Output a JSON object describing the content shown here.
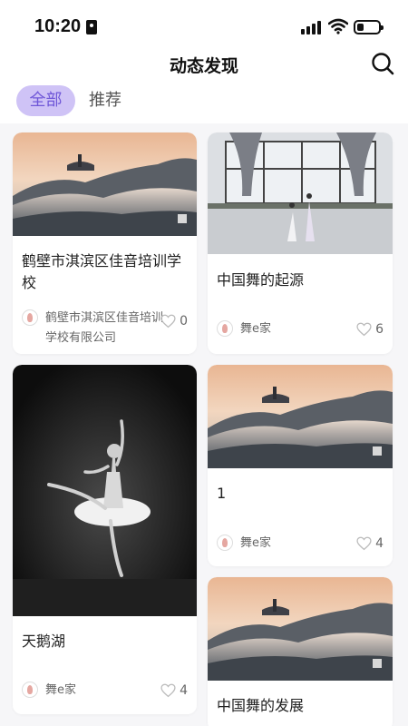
{
  "status_bar": {
    "time": "10:20"
  },
  "header": {
    "title": "动态发现"
  },
  "tabs": [
    {
      "label": "全部",
      "active": true
    },
    {
      "label": "推荐",
      "active": false
    }
  ],
  "cards": [
    {
      "title": "鹤壁市淇滨区佳音培训学校",
      "author": "鹤壁市淇滨区佳音培训学校有限公司",
      "likes": "0",
      "image": "landscape-pavilion"
    },
    {
      "title": "中国舞的起源",
      "author": "舞e家",
      "likes": "6",
      "image": "dance-studio"
    },
    {
      "title": "天鹅湖",
      "author": "舞e家",
      "likes": "4",
      "image": "ballerina-bw"
    },
    {
      "title": "1",
      "author": "舞e家",
      "likes": "4",
      "image": "landscape-pavilion"
    },
    {
      "title": "中国舞的发展",
      "author": "",
      "likes": "",
      "image": "landscape-pavilion"
    }
  ],
  "colors": {
    "accent": "#6f57d8",
    "accent_bg": "#cfc3f6",
    "page_bg": "#f6f6f8"
  }
}
